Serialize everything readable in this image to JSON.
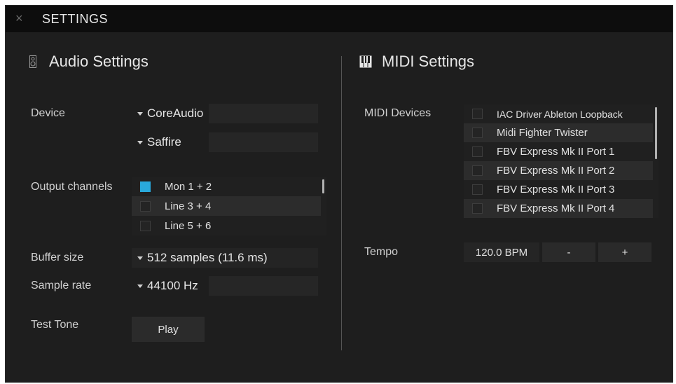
{
  "window": {
    "title": "SETTINGS",
    "close_glyph": "×"
  },
  "audio": {
    "title": "Audio Settings",
    "device_label": "Device",
    "device_driver": "CoreAudio",
    "device_interface": "Saffire",
    "output_channels_label": "Output channels",
    "output_channels": [
      {
        "label": "Mon 1 + 2",
        "checked": true
      },
      {
        "label": "Line 3 + 4",
        "checked": false
      },
      {
        "label": "Line 5 + 6",
        "checked": false
      }
    ],
    "buffer_size_label": "Buffer size",
    "buffer_size_value": "512 samples (11.6 ms)",
    "sample_rate_label": "Sample rate",
    "sample_rate_value": "44100 Hz",
    "test_tone_label": "Test Tone",
    "play_label": "Play"
  },
  "midi": {
    "title": "MIDI Settings",
    "devices_label": "MIDI Devices",
    "devices": [
      {
        "label": "IAC Driver Ableton Loopback",
        "checked": false
      },
      {
        "label": "Midi Fighter Twister",
        "checked": false
      },
      {
        "label": "FBV Express Mk II Port 1",
        "checked": false
      },
      {
        "label": "FBV Express Mk II Port 2",
        "checked": false
      },
      {
        "label": "FBV Express Mk II Port 3",
        "checked": false
      },
      {
        "label": "FBV Express Mk II Port 4",
        "checked": false
      }
    ],
    "tempo_label": "Tempo",
    "tempo_value": "120.0 BPM",
    "tempo_minus": "-",
    "tempo_plus": "+"
  },
  "colors": {
    "accent": "#29a9dc",
    "background": "#1e1e1e",
    "titlebar": "#0d0d0d"
  },
  "icons": {
    "audio": "speaker-icon",
    "midi": "piano-keys-icon",
    "close": "close-icon",
    "dropdown": "caret-down-icon"
  }
}
